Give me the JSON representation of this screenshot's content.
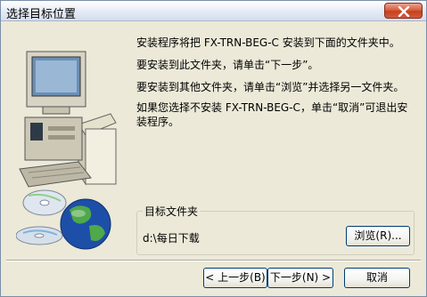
{
  "window": {
    "title": "选择目标位置"
  },
  "messages": [
    "安装程序将把 FX-TRN-BEG-C 安装到下面的文件夹中。",
    "要安装到此文件夹，请单击“下一步”。",
    "要安装到其他文件夹，请单击“浏览”并选择另一文件夹。",
    "如果您选择不安装 FX-TRN-BEG-C，单击“取消”可退出安",
    "装程序。"
  ],
  "destination": {
    "group_label": "目标文件夹",
    "path": "d:\\每日下载",
    "browse_label": "浏览(R)..."
  },
  "buttons": {
    "back": "< 上一步(B)",
    "next": "下一步(N) >",
    "cancel": "取消"
  },
  "icons": {
    "close": "close-icon",
    "computer": "computer-illustration-icon",
    "cd": "cd-disc-icon",
    "globe": "globe-icon"
  },
  "colors": {
    "dialog_bg": "#ece9d8",
    "close_button": "#d9603e",
    "button_border": "#003c74"
  }
}
